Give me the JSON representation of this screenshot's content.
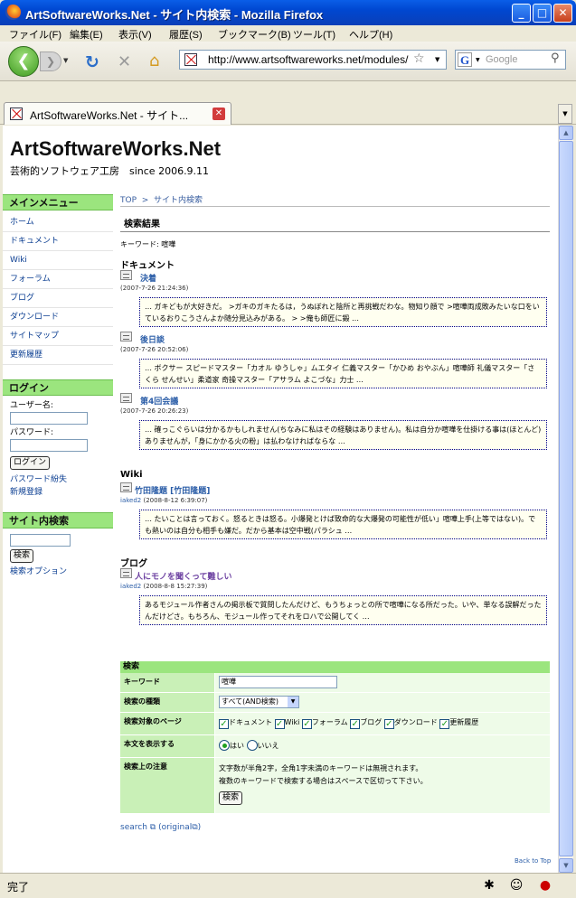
{
  "window": {
    "title": "ArtSoftwareWorks.Net - サイト内検索 - Mozilla Firefox",
    "min": "_",
    "max": "□",
    "close": "✕"
  },
  "menu": [
    "ファイル(F)",
    "編集(E)",
    "表示(V)",
    "履歴(S)",
    "ブックマーク(B)",
    "ツール(T)",
    "ヘルプ(H)"
  ],
  "nav": {
    "url": "http://www.artsoftwareworks.net/modules/",
    "search_placeholder": "Google",
    "search_engine_letter": "G"
  },
  "tab": {
    "title": "ArtSoftwareWorks.Net - サイト..."
  },
  "site": {
    "title": "ArtSoftwareWorks.Net",
    "subtitle": "芸術的ソフトウェア工房　since 2006.9.11"
  },
  "sidebar": {
    "main_menu_title": "メインメニュー",
    "items": [
      "ホーム",
      "ドキュメント",
      "Wiki",
      "フォーラム",
      "ブログ",
      "ダウンロード",
      "サイトマップ",
      "更新履歴"
    ],
    "login": {
      "title": "ログイン",
      "username_label": "ユーザー名:",
      "password_label": "パスワード:",
      "button": "ログイン",
      "lost_password": "パスワード紛失",
      "register": "新規登録"
    },
    "search": {
      "title": "サイト内検索",
      "button": "検索",
      "options": "検索オプション"
    }
  },
  "main": {
    "breadcrumb": {
      "top": "TOP",
      "sep": ">",
      "current": "サイト内検索"
    },
    "results_heading": "検索結果",
    "keyword_line": "キーワード: 喧嘩",
    "sections": [
      {
        "title": "ドキュメント",
        "hits": [
          {
            "title": "決着",
            "meta": "(2007-7-26 21:24:36)",
            "poster": "",
            "snippet": "… ガキどもが大好きだ。 >ガキのガキたるは，うぬぼれと陰所と再挑戦だわな。物知り顔で >喧嘩両成敗みたいな口をいているおりこうさんよか随分見込みがある。 > >俺も師匠に鍛 …"
          },
          {
            "title": "後日談",
            "meta": "(2007-7-26 20:52:06)",
            "poster": "",
            "snippet": "… ボクサー スピードマスター「カオル ゆうしゃ」ムエタイ 仁義マスター「かひめ おやぶん」喧嘩師 礼儀マスター「さくら せんせい」柔道家 奇操マスター「アサラム よこづな」力士 …"
          },
          {
            "title": "第4回会議",
            "meta": "(2007-7-26 20:26:23)",
            "poster": "",
            "snippet": "… 確っこぐらいは分かるかもしれません(ちなみに私はその経験はありません)。私は自分か喧嘩を仕掛ける事は(ほとんど)ありませんが，「身にかかる火の粉」は払わなければならな …"
          }
        ]
      },
      {
        "title": "Wiki",
        "hits": [
          {
            "title": "竹田隆題 [竹田隆題]",
            "meta": " (2008-8-12 6:39:07)",
            "poster": "iaked2",
            "snippet": "… たいことは言っておく。怒るときは怒る。小爆発とけば致命的な大爆発の可能性が低い」喧嘩上手(上等ではない)。でも熱いのは自分も相手も嫌だ。だから基本は空中戦(パラシュ …"
          }
        ]
      },
      {
        "title": "ブログ",
        "hits": [
          {
            "title": "人にモノを聞くって難しい",
            "meta": " (2008-8-8 15:27:39)",
            "poster": "iaked2",
            "snippet": "あるモジュール作者さんの掲示板で質問したんだけど、もうちょっとの所で喧嘩になる所だった。いや、単なる誤解だったんだけどさ。もちろん、モジュール作ってそれをロハで公開してく …"
          }
        ]
      }
    ],
    "search_form": {
      "title": "検索",
      "rows": {
        "keyword_label": "キーワード",
        "keyword_value": "喧嘩",
        "type_label": "検索の種類",
        "type_value": "すべて(AND検索)",
        "targets_label": "検索対象のページ",
        "targets": [
          "ドキュメント",
          "Wiki",
          "フォーラム",
          "ブログ",
          "ダウンロード",
          "更新履歴"
        ],
        "show_body_label": "本文を表示する",
        "show_body_yes": "はい",
        "show_body_no": "いいえ",
        "notes_label": "検索上の注意",
        "note1": "文字数が半角2字，全角1字未満のキーワードは無視されます。",
        "note2": "複数のキーワードで検索する場合はスペースで区切って下さい。",
        "submit": "検索"
      }
    },
    "footer_links": {
      "search": "search",
      "original": "original"
    },
    "back_to_top": "Back to Top"
  },
  "status": {
    "text": "完了"
  }
}
